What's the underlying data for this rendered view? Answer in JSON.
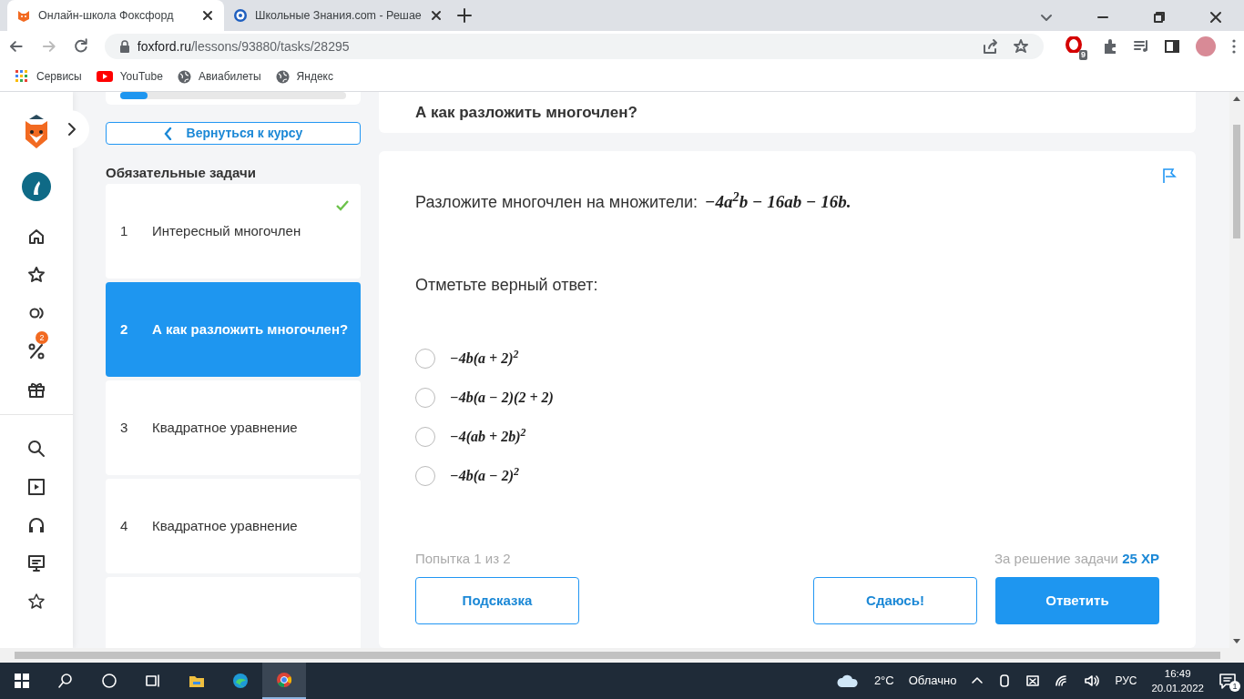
{
  "browser": {
    "tabs": [
      {
        "title": "Онлайн-школа Фоксфорд",
        "selected": true
      },
      {
        "title": "Школьные Знания.com - Решае",
        "selected": false
      }
    ],
    "url": {
      "host": "foxford.ru",
      "path": "/lessons/93880/tasks/28295"
    },
    "extension_badge": "9",
    "bookmarks": [
      {
        "label": "Сервисы",
        "kind": "apps"
      },
      {
        "label": "YouTube",
        "kind": "youtube"
      },
      {
        "label": "Авиабилеты",
        "kind": "globe"
      },
      {
        "label": "Яндекс",
        "kind": "globe"
      }
    ]
  },
  "rail": {
    "discount_badge": "2"
  },
  "sidebar": {
    "back_button": "Вернуться к курсу",
    "section_title": "Обязательные задачи",
    "tasks": [
      {
        "number": "1",
        "title": "Интересный многочлен",
        "selected": false,
        "solved": true
      },
      {
        "number": "2",
        "title": "А как разложить многочлен?",
        "selected": true,
        "solved": false
      },
      {
        "number": "3",
        "title": "Квадратное уравнение",
        "selected": false,
        "solved": false
      },
      {
        "number": "4",
        "title": "Квадратное уравнение",
        "selected": false,
        "solved": false
      }
    ]
  },
  "lesson_title": "А как разложить многочлен?",
  "task": {
    "question": "Разложите многочлен на множители:",
    "formula": "−4a$^{2}$b − 16ab − 16b.",
    "prompt": "Отметьте верный ответ:",
    "options": [
      {
        "text": "−4b(a + 2)$^{2}$",
        "selected": false
      },
      {
        "text": "−4b(a − 2)(2 + 2)",
        "selected": false
      },
      {
        "text": "−4(ab + 2b)$^{2}$",
        "selected": false
      },
      {
        "text": "−4b(a − 2)$^{2}$",
        "selected": false
      }
    ],
    "attempt": "Попытка 1 из 2",
    "reward_label": "За решение задачи",
    "reward_value": "25 XP",
    "hint_button": "Подсказка",
    "give_up_button": "Сдаюсь!",
    "answer_button": "Ответить"
  },
  "taskbar": {
    "temperature": "2°C",
    "weather": "Облачно",
    "language": "РУС",
    "time": "16:49",
    "date": "20.01.2022",
    "notifications": "1"
  }
}
